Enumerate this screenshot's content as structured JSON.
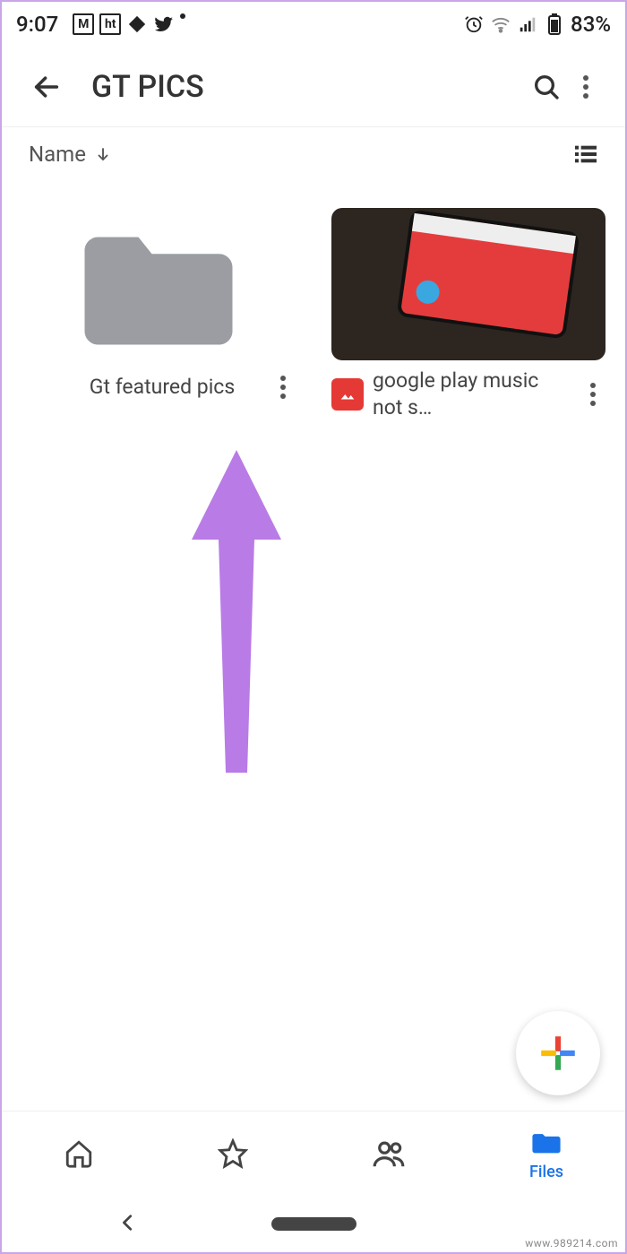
{
  "status": {
    "time": "9:07",
    "battery_pct": "83%"
  },
  "app_bar": {
    "title": "GT PICS"
  },
  "sort": {
    "label": "Name"
  },
  "items": [
    {
      "type": "folder",
      "label": "Gt featured pics"
    },
    {
      "type": "image",
      "label": "google play music not s…"
    }
  ],
  "fab": {
    "name": "add"
  },
  "bottom_nav": {
    "home": "",
    "starred": "",
    "shared": "",
    "files": "Files"
  },
  "watermark": "www.989214.com"
}
